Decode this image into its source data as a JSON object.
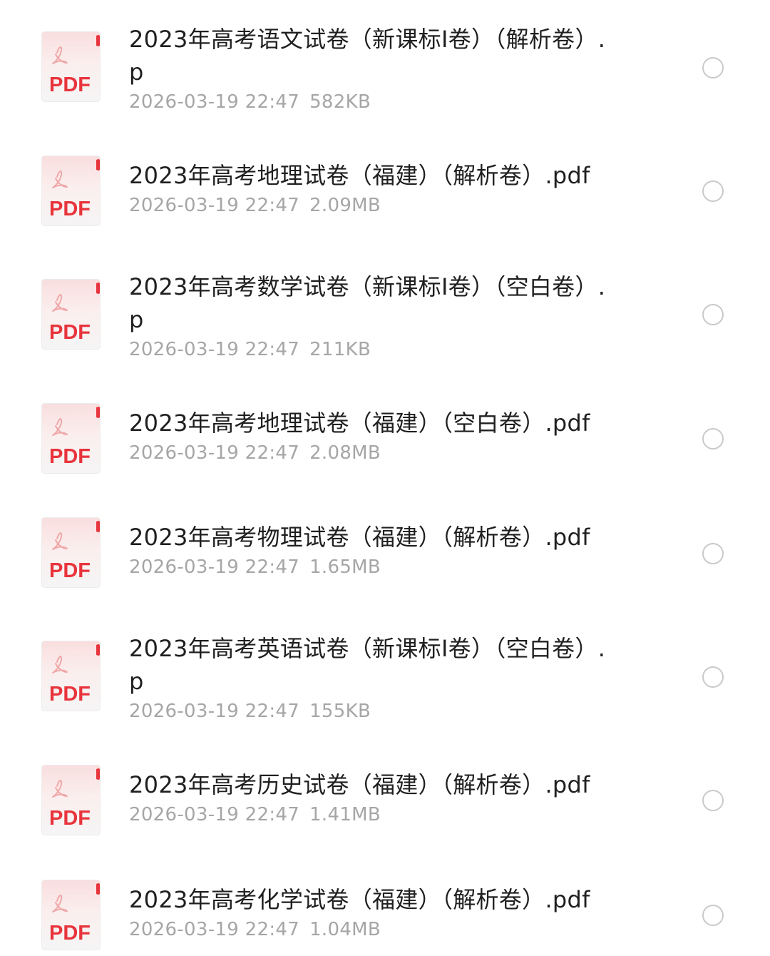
{
  "icon": {
    "name": "pdf-file-icon",
    "label": "PDF",
    "accent_color": "#e8343c"
  },
  "files": [
    {
      "name": "2023年高考语文试卷（新课标Ⅰ卷）（解析卷）.p",
      "date": "2026-03-19 22:47",
      "size": "582KB"
    },
    {
      "name": "2023年高考地理试卷（福建）（解析卷）.pdf",
      "date": "2026-03-19 22:47",
      "size": "2.09MB"
    },
    {
      "name": "2023年高考数学试卷（新课标Ⅰ卷）（空白卷）.p",
      "date": "2026-03-19 22:47",
      "size": "211KB"
    },
    {
      "name": "2023年高考地理试卷（福建）（空白卷）.pdf",
      "date": "2026-03-19 22:47",
      "size": "2.08MB"
    },
    {
      "name": "2023年高考物理试卷（福建）（解析卷）.pdf",
      "date": "2026-03-19 22:47",
      "size": "1.65MB"
    },
    {
      "name": "2023年高考英语试卷（新课标Ⅰ卷）（空白卷）.p",
      "date": "2026-03-19 22:47",
      "size": "155KB"
    },
    {
      "name": "2023年高考历史试卷（福建）（解析卷）.pdf",
      "date": "2026-03-19 22:47",
      "size": "1.41MB"
    },
    {
      "name": "2023年高考化学试卷（福建）（解析卷）.pdf",
      "date": "2026-03-19 22:47",
      "size": "1.04MB"
    }
  ]
}
